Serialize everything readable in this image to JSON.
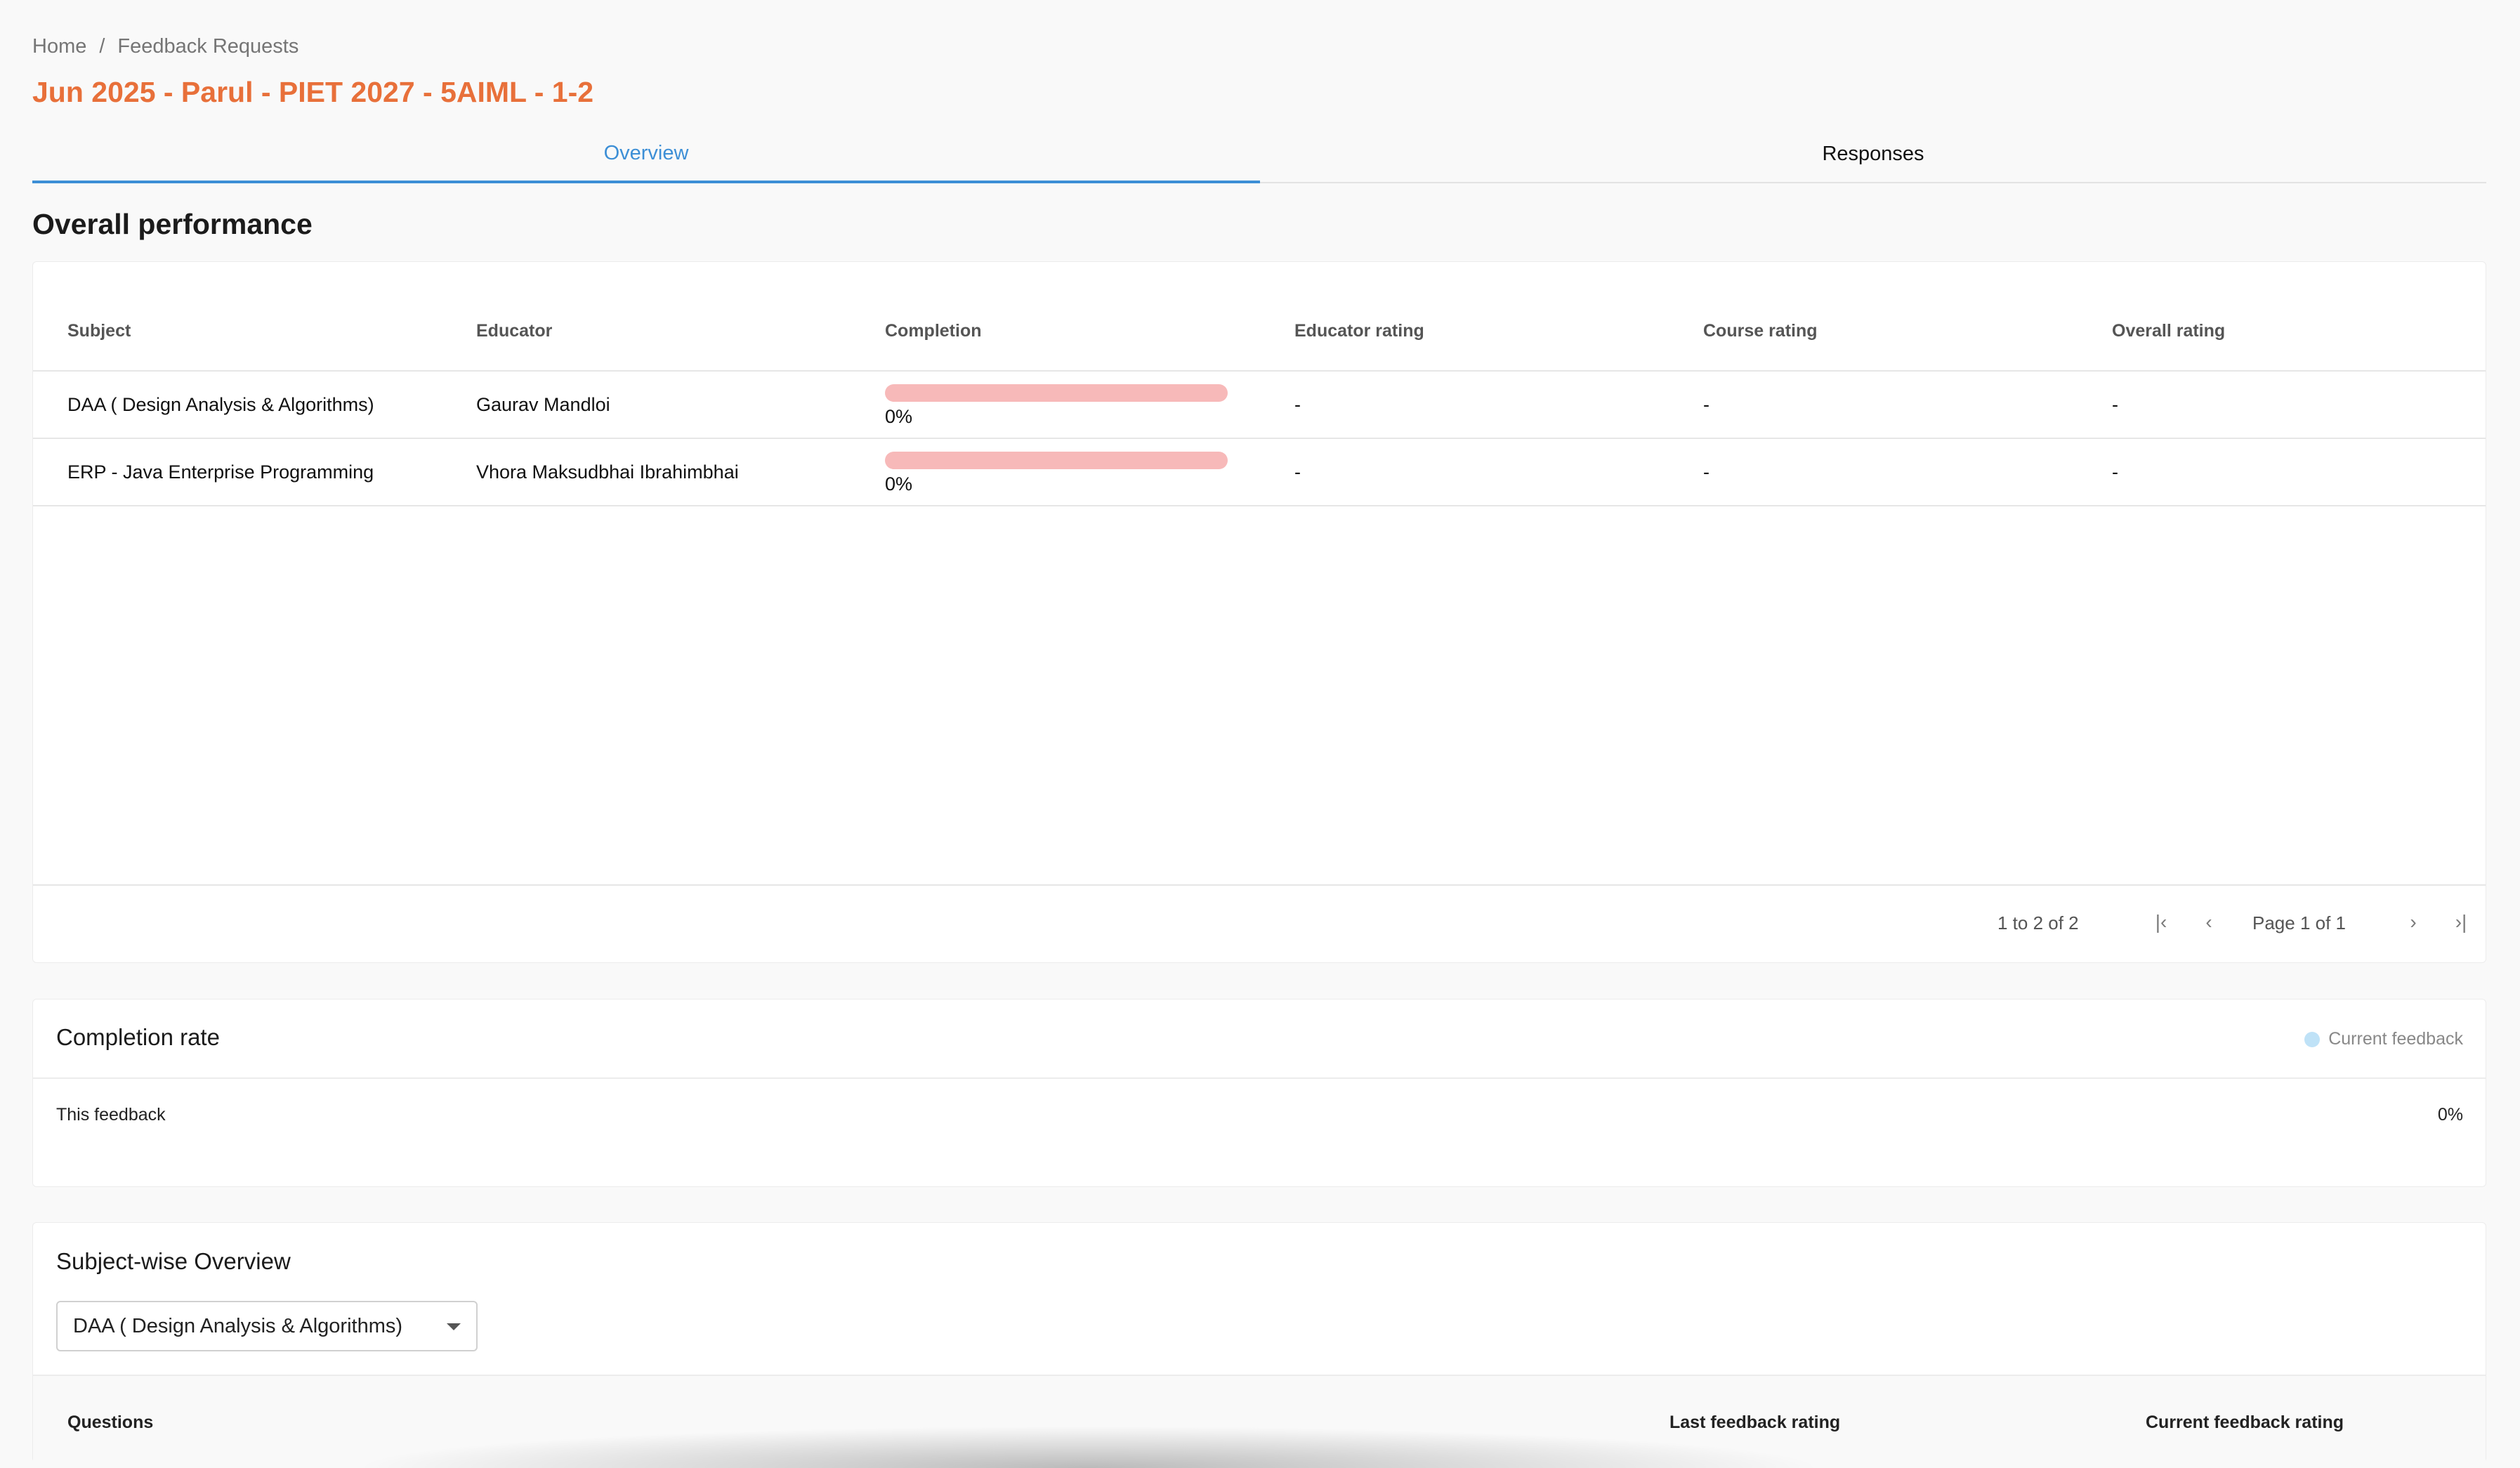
{
  "breadcrumb": {
    "home": "Home",
    "separator": "/",
    "current": "Feedback Requests"
  },
  "page_title": "Jun 2025 - Parul - PIET 2027 - 5AIML - 1-2",
  "tabs": [
    {
      "label": "Overview",
      "active": true
    },
    {
      "label": "Responses",
      "active": false
    }
  ],
  "overall_performance": {
    "title": "Overall performance",
    "columns": [
      "Subject",
      "Educator",
      "Completion",
      "Educator rating",
      "Course rating",
      "Overall rating"
    ],
    "rows": [
      {
        "subject": "DAA ( Design Analysis & Algorithms)",
        "educator": "Gaurav Mandloi",
        "completion": "0%",
        "completion_value": 0,
        "educator_rating": "-",
        "course_rating": "-",
        "overall_rating": "-"
      },
      {
        "subject": "ERP - Java Enterprise Programming",
        "educator": "Vhora Maksudbhai Ibrahimbhai",
        "completion": "0%",
        "completion_value": 0,
        "educator_rating": "-",
        "course_rating": "-",
        "overall_rating": "-"
      }
    ],
    "pager": {
      "range": "1 to 2 of 2",
      "page": "Page 1 of 1",
      "first_icon": "first-page-icon",
      "prev_icon": "chevron-left-icon",
      "next_icon": "chevron-right-icon",
      "last_icon": "last-page-icon"
    }
  },
  "completion_rate": {
    "title": "Completion rate",
    "legend": "Current feedback",
    "legend_color": "#bfe2f7",
    "label": "This feedback",
    "value": "0%"
  },
  "subject_overview": {
    "title": "Subject-wise Overview",
    "selected_subject": "DAA ( Design Analysis & Algorithms)",
    "columns": [
      "Questions",
      "Last feedback rating",
      "Current feedback rating"
    ]
  },
  "colors": {
    "accent": "#e8703a",
    "tab_active": "#3d8fd6",
    "progress_track": "#f7b9b9"
  }
}
